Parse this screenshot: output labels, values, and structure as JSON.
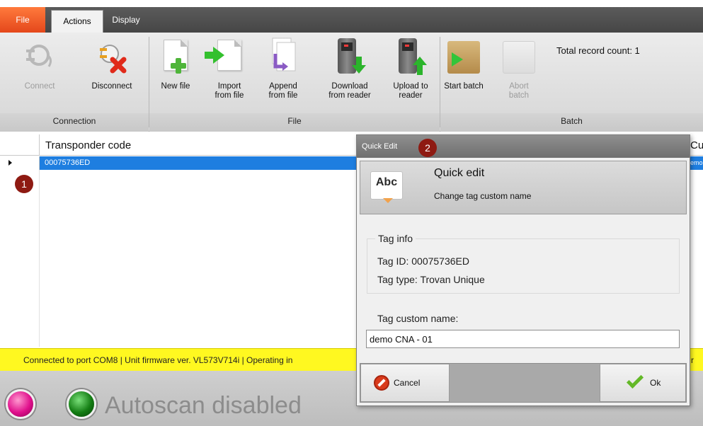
{
  "tabs": {
    "file": "File",
    "actions": "Actions",
    "display": "Display"
  },
  "ribbon": {
    "connect": "Connect",
    "disconnect": "Disconnect",
    "new_file": "New file",
    "import_1": "Import",
    "import_2": "from file",
    "append_1": "Append",
    "append_2": "from file",
    "download_1": "Download",
    "download_2": "from reader",
    "upload_1": "Upload to",
    "upload_2": "reader",
    "start_batch": "Start batch",
    "abort_1": "Abort",
    "abort_2": "batch",
    "total_record": "Total record count:  1",
    "groups": {
      "connection": "Connection",
      "file": "File",
      "batch": "Batch"
    }
  },
  "grid": {
    "col_transponder": "Transponder code",
    "col_custom": "Cu",
    "row_code": "00075736ED",
    "row_custom": "emo"
  },
  "badges": {
    "one": "1",
    "two": "2"
  },
  "status": {
    "text": "Connected to port COM8 | Unit firmware ver. VL573V714i | Operating in",
    "rest": "r"
  },
  "bottom": {
    "autoscan": "Autoscan disabled"
  },
  "dialog": {
    "title": "Quick Edit",
    "heading": "Quick edit",
    "subheading": "Change tag custom name",
    "abc": "Abc",
    "tag_info_legend": "Tag info",
    "tag_id": "Tag ID: 00075736ED",
    "tag_type": "Tag type: Trovan Unique",
    "custom_name_label": "Tag custom name:",
    "custom_name_value": "demo CNA - 01",
    "cancel": "Cancel",
    "ok": "Ok"
  },
  "colors": {
    "file_tab": "#e4471b",
    "selection": "#1e7ee0",
    "status_bar": "#fff820",
    "badge": "#8e1a12"
  }
}
